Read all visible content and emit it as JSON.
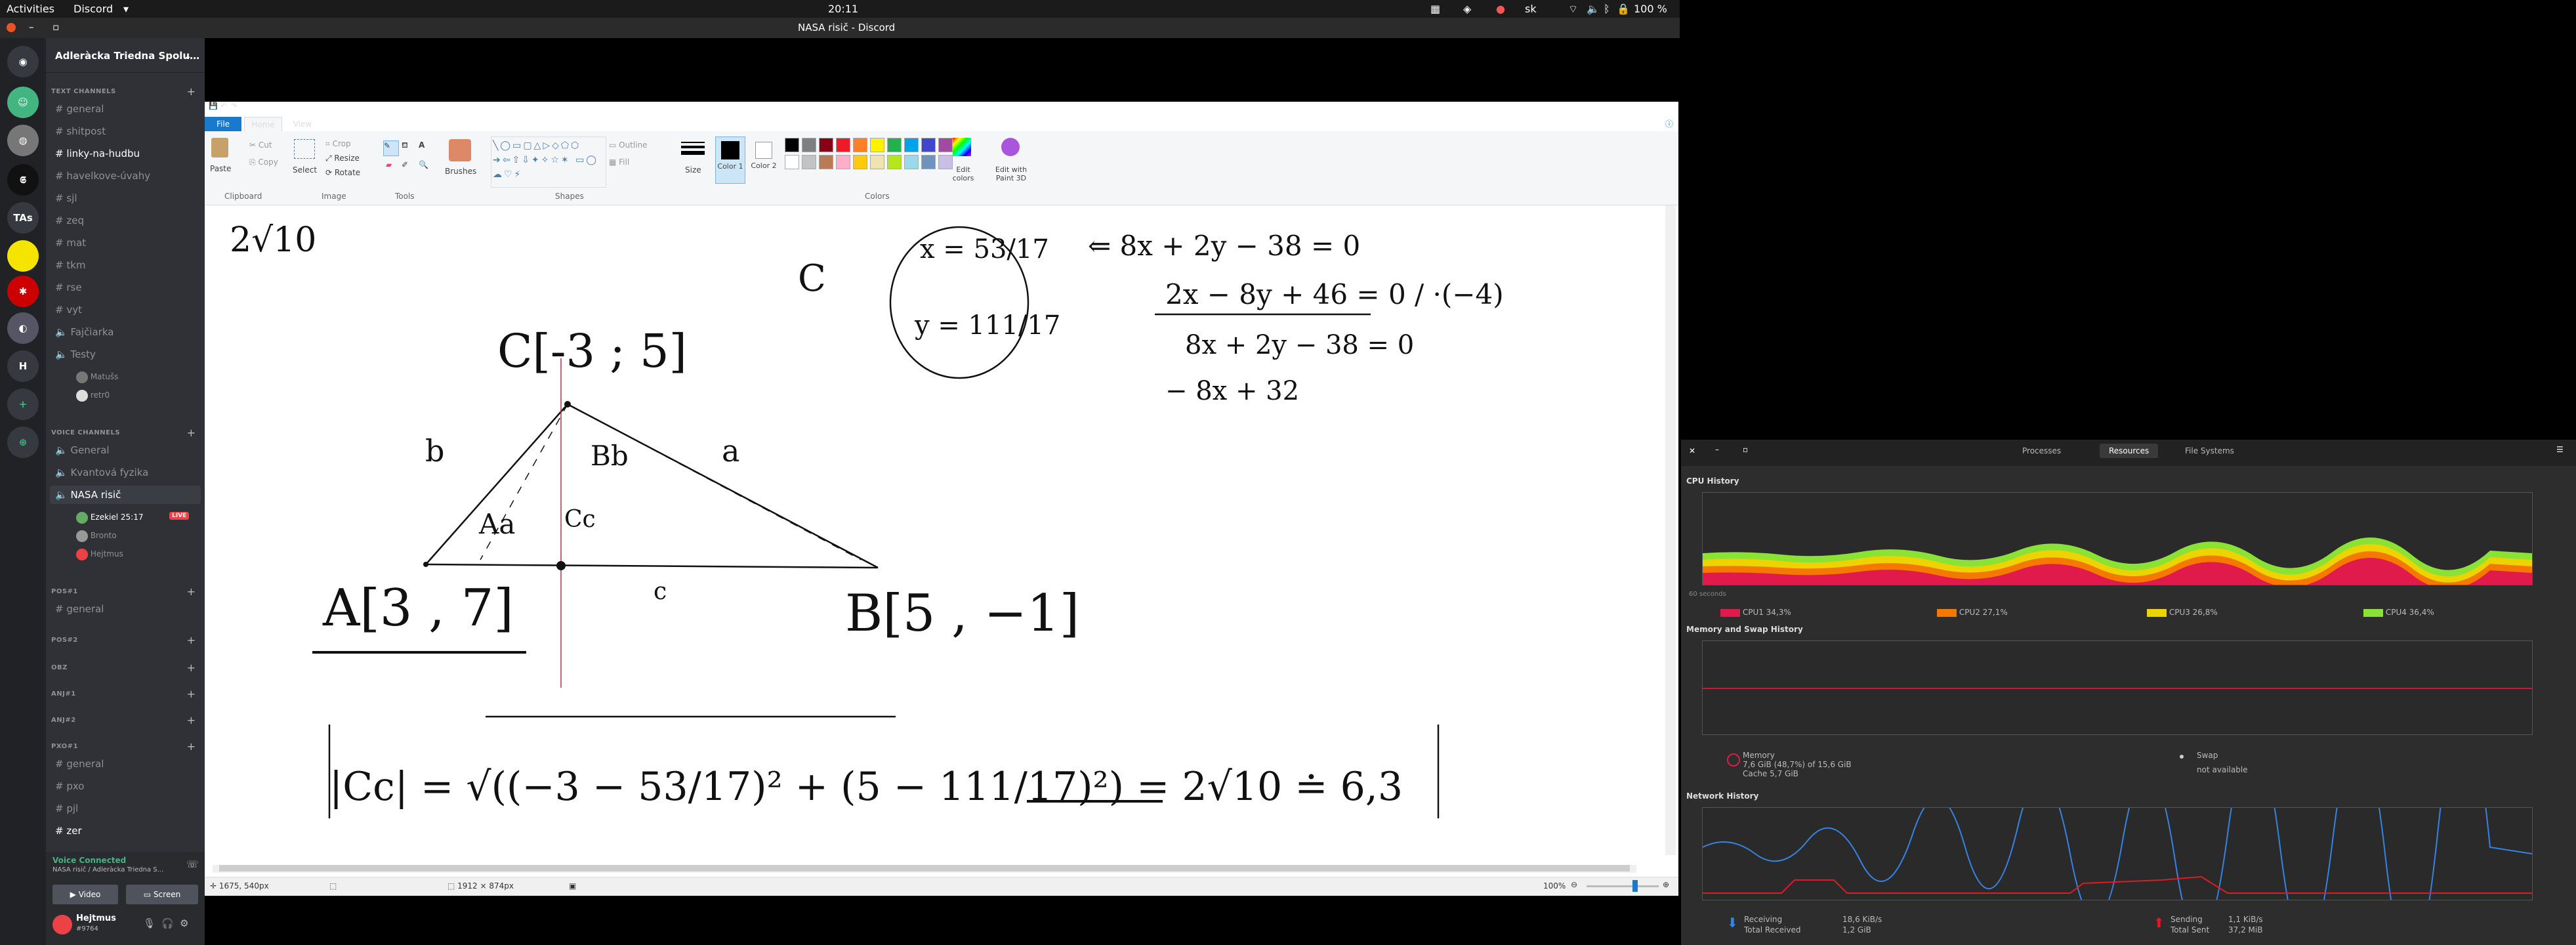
{
  "topbar": {
    "activities": "Activities",
    "app": "Discord",
    "clock": "20:11",
    "lang": "sk",
    "battery": "100 %"
  },
  "window": {
    "title": "NASA risič - Discord"
  },
  "discord": {
    "server_name": "Adleràcka Triedna Spolu…",
    "guild_labels": [
      "TAs",
      "H"
    ],
    "text_category": "TEXT CHANNELS",
    "text_channels": [
      "general",
      "shitpost",
      "linky-na-hudbu",
      "havelkove-úvahy",
      "sjl",
      "zeq",
      "mat",
      "tkm",
      "rse",
      "vyt"
    ],
    "other_channels": [
      "Fajčiarka",
      "Testy"
    ],
    "testy_users": [
      "Matušs",
      "retr0"
    ],
    "voice_category": "VOICE CHANNELS",
    "voice_channels": [
      "General",
      "Kvantová fyzika",
      "NASA risič"
    ],
    "voice_users": [
      "Ezekiel 25:17",
      "Bronto",
      "Hejtmus"
    ],
    "live_badge": "LIVE",
    "cat_pos": "POS#1",
    "pos_general": "general",
    "cat_pos2": "POS#2",
    "cat_obz": "OBZ",
    "cat_anj1": "ANJ#1",
    "cat_anj2": "ANJ#2",
    "cat_pxo": "PXO#1",
    "pxo_channels": [
      "general",
      "pxo",
      "pjl",
      "zer"
    ],
    "voice_connected": "Voice Connected",
    "voice_connected_sub": "NASA risič / Adleràcka Triedna S...",
    "video_btn": "Video",
    "screen_btn": "Screen",
    "user_name": "Hejtmus",
    "user_tag": "#9764"
  },
  "paint": {
    "tabs": [
      "File",
      "Home",
      "View"
    ],
    "clipboard": {
      "paste": "Paste",
      "cut": "Cut",
      "copy": "Copy",
      "group": "Clipboard"
    },
    "image": {
      "select": "Select",
      "crop": "Crop",
      "resize": "Resize",
      "rotate": "Rotate",
      "group": "Image"
    },
    "tools_group": "Tools",
    "brushes": "Brushes",
    "shapes": {
      "outline": "Outline",
      "fill": "Fill",
      "group": "Shapes"
    },
    "size": "Size",
    "color1": "Color 1",
    "color2": "Color 2",
    "edit_colors": "Edit colors",
    "edit_3d": "Edit with Paint 3D",
    "colors_group": "Colors",
    "palette": [
      "#000000",
      "#7f7f7f",
      "#880015",
      "#ed1c24",
      "#ff7f27",
      "#fff200",
      "#22b14c",
      "#00a2e8",
      "#3f48cc",
      "#a349a4",
      "#ffffff",
      "#c3c3c3",
      "#b97a57",
      "#ffaec9",
      "#ffc90e",
      "#efe4b0",
      "#b5e61d",
      "#99d9ea",
      "#7092be",
      "#c8bfe7"
    ],
    "status_pos": "1675, 540px",
    "status_size": "1912 × 874px",
    "zoom": "100%"
  },
  "drawing": {
    "t1": "2√10",
    "t2": "C",
    "t3": "C[-3 ; 5]",
    "t4": "x = 53/17",
    "t5": "y = 111/17",
    "t6": "⇐  8x + 2y − 38 = 0",
    "t7": "2x − 8y + 46 = 0  / ·(−4)",
    "t8": "8x + 2y − 38 = 0",
    "t9": "− 8x + 32",
    "t10": "A[3 , 7]",
    "t11": "B[5 , −1]",
    "t12": "|Cc| = √((−3 − 53/17)² + (5 − 111/17)²)  =  2√10  ≐ 6,3",
    "lbl_b": "b",
    "lbl_a": "a",
    "lbl_c": "c",
    "lbl_bb": "Bb",
    "lbl_aa": "Aa",
    "lbl_cc": "Cc"
  },
  "sysmon": {
    "tabs": [
      "Processes",
      "Resources",
      "File Systems"
    ],
    "cpu_title": "CPU History",
    "cpu_legend": [
      "CPU1 34,3%",
      "CPU2 27,1%",
      "CPU3 26,8%",
      "CPU4 36,4%"
    ],
    "cpu_colors": [
      "#e01b4c",
      "#f57900",
      "#edd400",
      "#8ae234"
    ],
    "mem_title": "Memory and Swap History",
    "memory_label": "Memory",
    "memory_detail": "7,6 GiB (48,7%) of 15,6 GiB",
    "memory_cache": "Cache 5,7 GiB",
    "swap_label": "Swap",
    "swap_detail": "not available",
    "net_title": "Network History",
    "receiving": "Receiving",
    "receiving_val": "18,6 KiB/s",
    "total_received": "Total Received",
    "total_received_val": "1,2 GiB",
    "sending": "Sending",
    "sending_val": "1,1 KiB/s",
    "total_sent": "Total Sent",
    "total_sent_val": "37,2 MiB",
    "xlabel_start": "60 seconds"
  }
}
